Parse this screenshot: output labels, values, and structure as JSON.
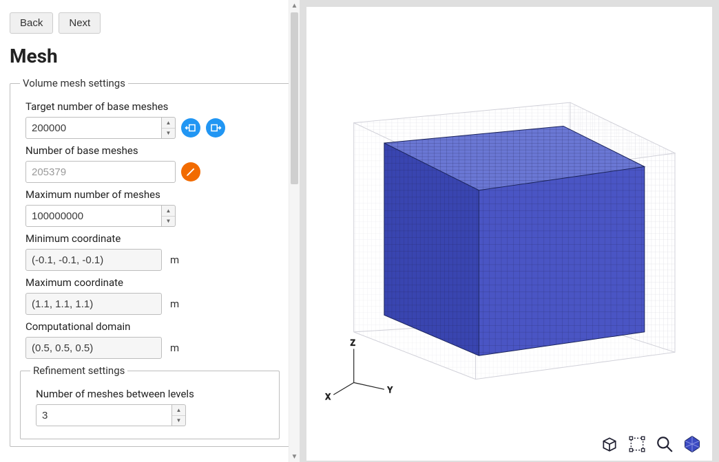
{
  "nav": {
    "back_label": "Back",
    "next_label": "Next"
  },
  "page_title": "Mesh",
  "volume_mesh": {
    "legend": "Volume mesh settings",
    "target_base_label": "Target number of base meshes",
    "target_base_value": "200000",
    "num_base_label": "Number of base meshes",
    "num_base_value": "205379",
    "max_meshes_label": "Maximum number of meshes",
    "max_meshes_value": "100000000",
    "min_coord_label": "Minimum coordinate",
    "min_coord_value": "(-0.1, -0.1, -0.1)",
    "max_coord_label": "Maximum coordinate",
    "max_coord_value": "(1.1, 1.1, 1.1)",
    "comp_domain_label": "Computational domain",
    "comp_domain_value": "(0.5, 0.5, 0.5)",
    "unit_m": "m"
  },
  "refinement": {
    "legend": "Refinement settings",
    "between_levels_label": "Number of meshes between levels",
    "between_levels_value": "3"
  },
  "axes": {
    "x": "X",
    "y": "Y",
    "z": "Z"
  },
  "icons": {
    "fit_hint": "Fit domain",
    "expand_hint": "Expand domain",
    "compute_hint": "Compute",
    "cube_hint": "Show solid",
    "bbox_hint": "Show bounds",
    "zoom_hint": "Zoom",
    "poly_hint": "Show polyhedron"
  }
}
